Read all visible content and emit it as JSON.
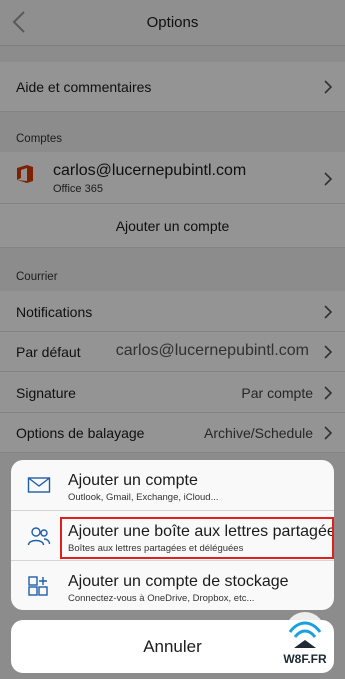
{
  "header": {
    "title": "Options"
  },
  "general": {
    "help": "Aide et commentaires"
  },
  "accounts": {
    "section": "Comptes",
    "email": "carlos@lucernepubintl.com",
    "type": "Office 365",
    "add": "Ajouter un compte"
  },
  "mail": {
    "section": "Courrier",
    "notifications": "Notifications",
    "default_label": "Par défaut",
    "default_value": "carlos@lucernepubintl.com",
    "signature_label": "Signature",
    "signature_value": "Par compte",
    "swipe_label": "Options de balayage",
    "swipe_value": "Archive/Schedule"
  },
  "sheet": {
    "items": [
      {
        "title": "Ajouter un compte",
        "subtitle": "Outlook, Gmail, Exchange, iCloud..."
      },
      {
        "title": "Ajouter une boîte aux lettres partagée",
        "subtitle": "Boîtes aux lettres partagées et déléguées"
      },
      {
        "title": "Ajouter un compte de stockage",
        "subtitle": "Connectez-vous à OneDrive, Dropbox, etc..."
      }
    ],
    "cancel": "Annuler"
  },
  "watermark": {
    "text": "W8F.FR"
  },
  "colors": {
    "highlight": "#e0201c",
    "office": "#d83b01",
    "icon_blue": "#1f5fa8"
  }
}
